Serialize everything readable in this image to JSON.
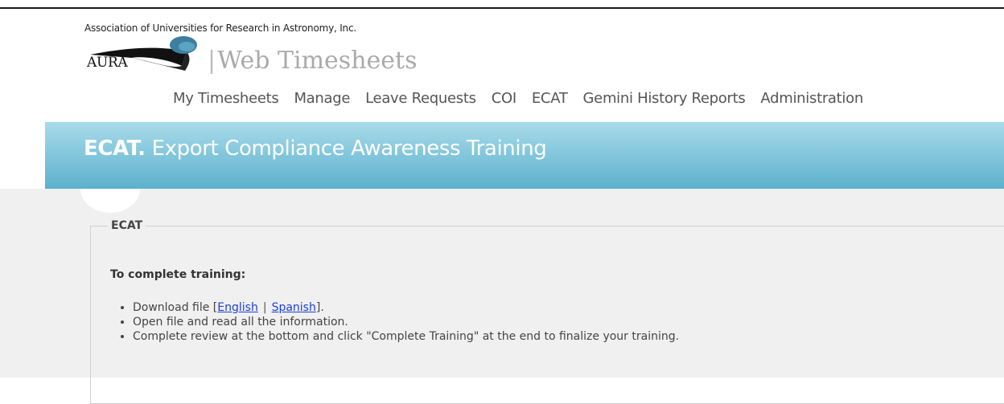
{
  "header": {
    "organization": "Association of Universities for Research in Astronomy, Inc.",
    "logo_text": "AURA",
    "app_title": "Web Timesheets"
  },
  "nav": {
    "items": [
      "My Timesheets",
      "Manage",
      "Leave Requests",
      "COI",
      "ECAT",
      "Gemini History Reports",
      "Administration"
    ]
  },
  "banner": {
    "abbr": "ECAT.",
    "title": "Export Compliance Awareness Training"
  },
  "section": {
    "legend": "ECAT",
    "intro": "To complete training:",
    "steps": {
      "download_prefix": "Download file [",
      "english": "English",
      "separator": "|",
      "spanish": "Spanish",
      "download_suffix": "].",
      "open": "Open file and read all the information.",
      "complete": "Complete review at the bottom and click \"Complete Training\" at the end to finalize your training."
    }
  },
  "colors": {
    "banner_top": "#a9dbe9",
    "banner_bottom": "#5cb1cc",
    "link": "#1a3fd6",
    "content_bg": "#f0f0f0"
  }
}
